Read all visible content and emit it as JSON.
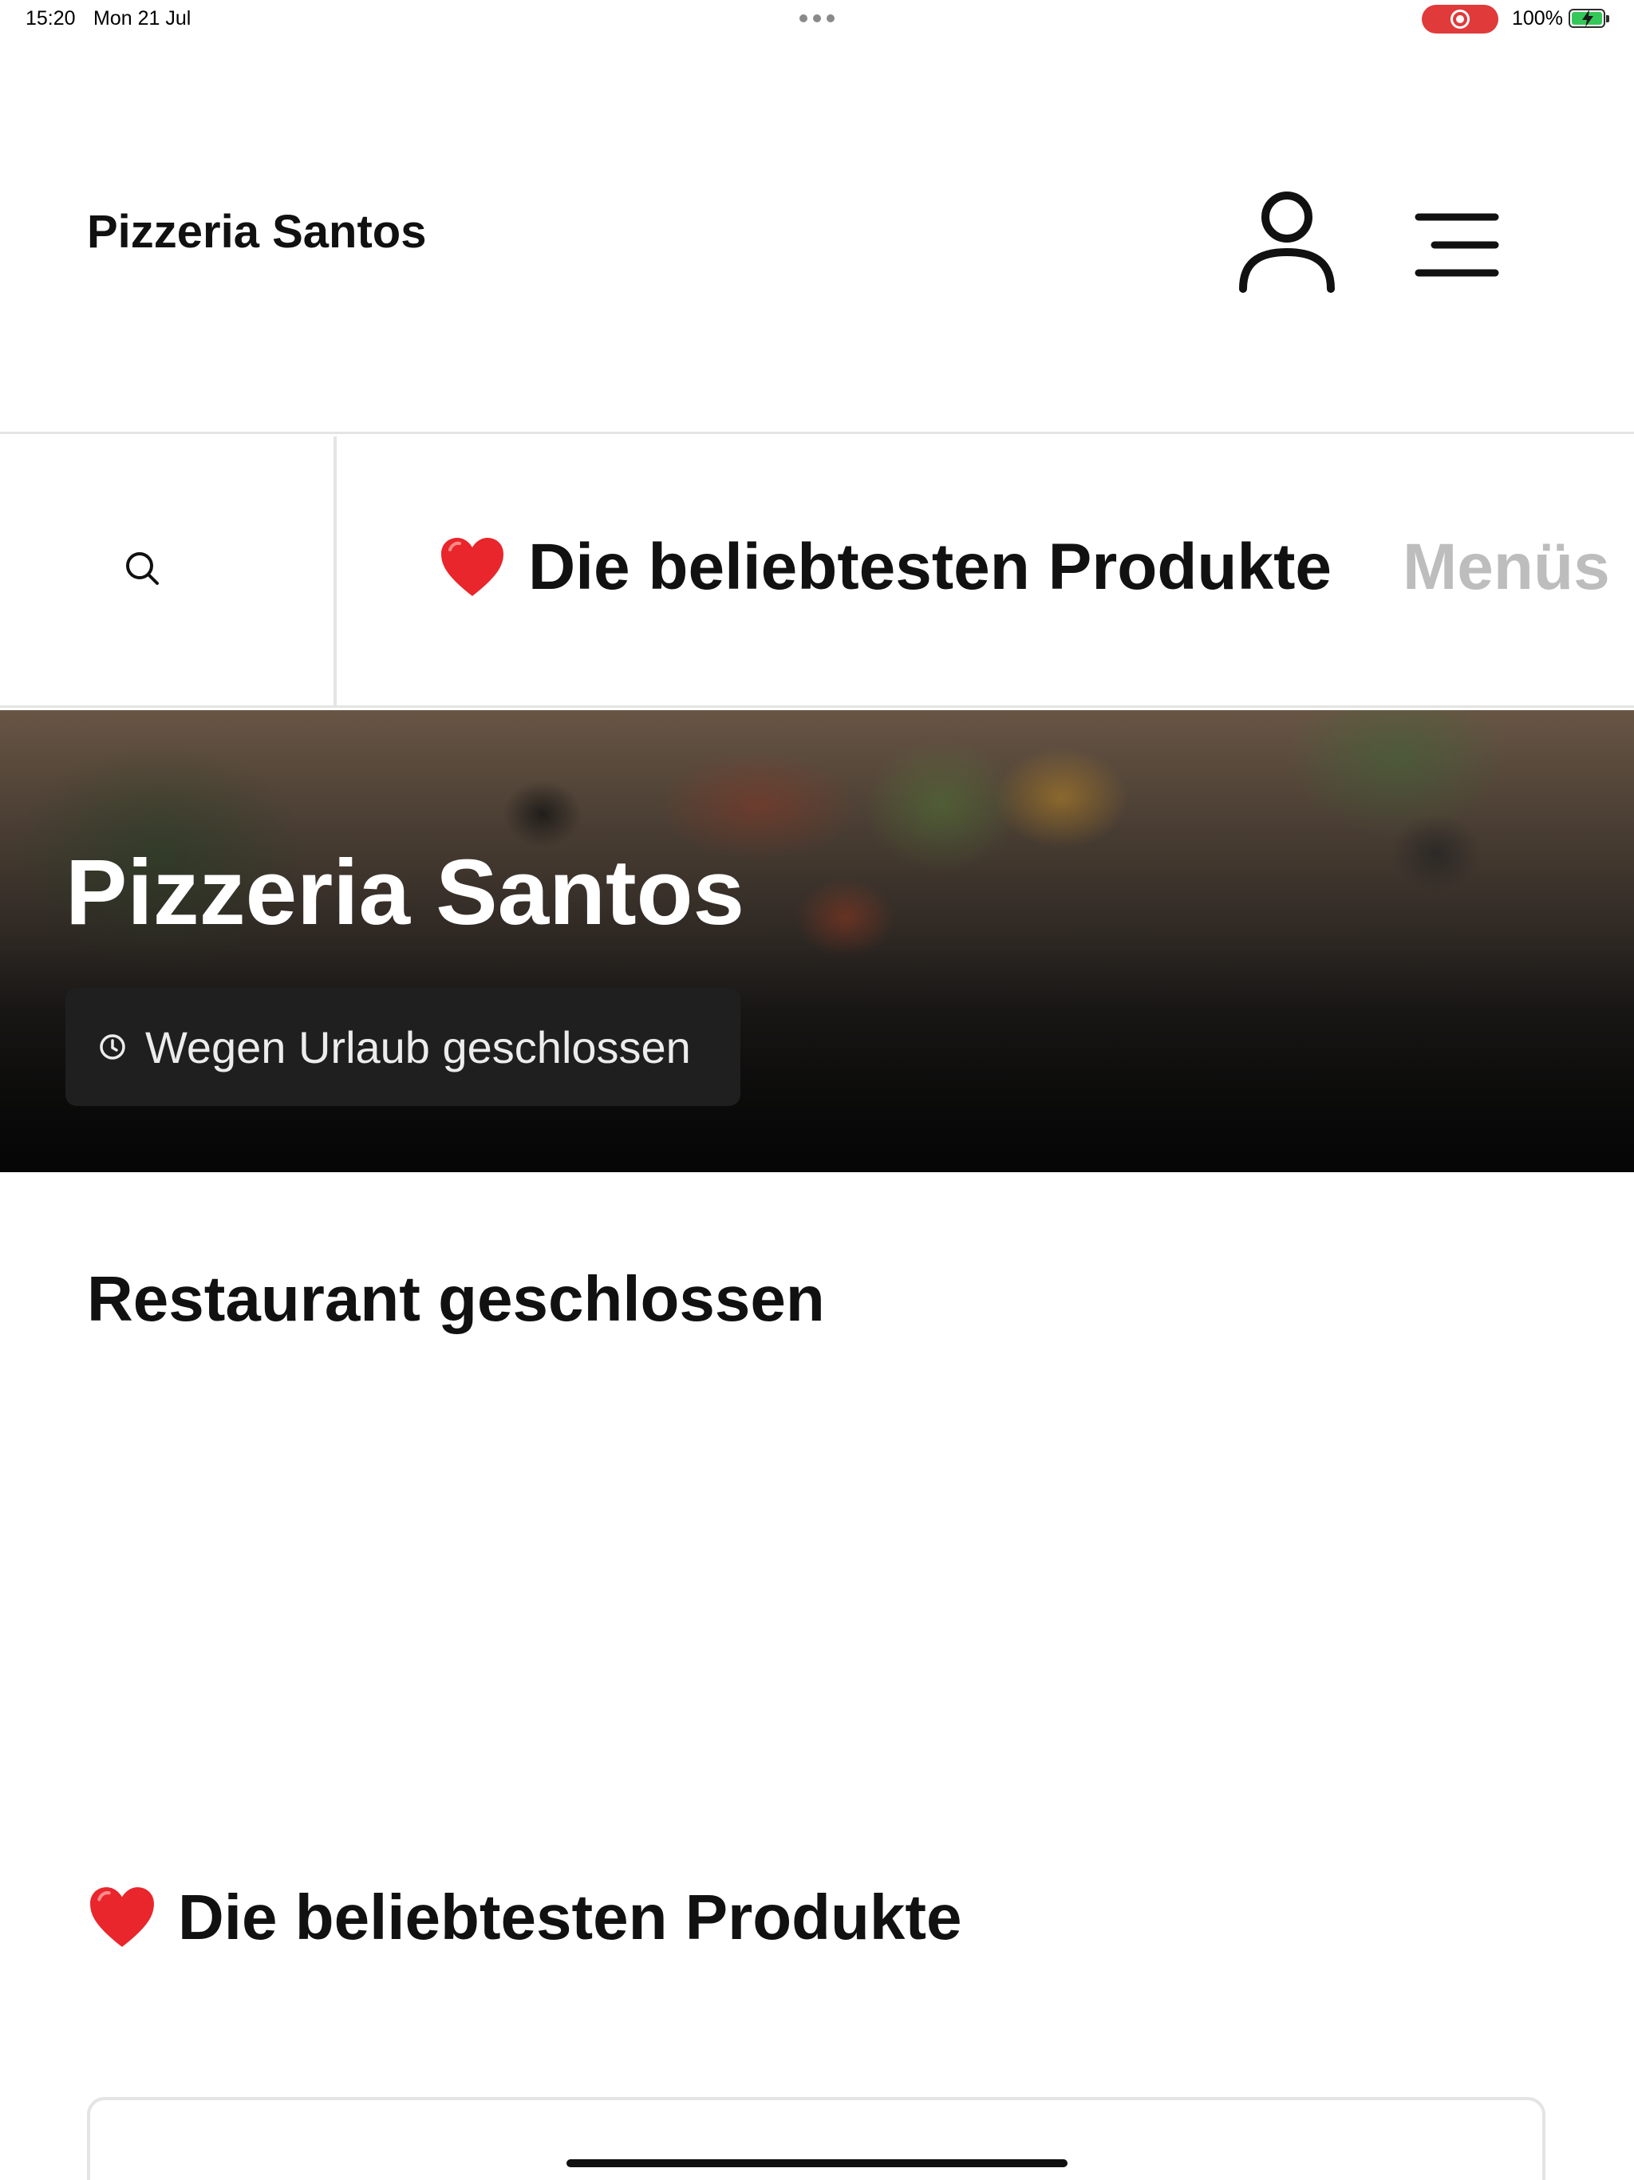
{
  "status_bar": {
    "time": "15:20",
    "date": "Mon 21 Jul",
    "battery_percent": "100%",
    "battery_level": 1.0,
    "screen_recording": true,
    "recording_color": "#e03a3a",
    "battery_color": "#35c759"
  },
  "header": {
    "brand": "Pizzeria Santos",
    "account_icon": "person-icon",
    "menu_icon": "hamburger-menu-icon"
  },
  "category_nav": {
    "search_icon": "search-icon",
    "tabs": [
      {
        "emoji": "❤️",
        "label": "Die beliebtesten Produkte",
        "active": true
      },
      {
        "label": "Menüs",
        "active": false
      }
    ]
  },
  "hero": {
    "title": "Pizzeria Santos",
    "status_icon": "clock-icon",
    "status_text": "Wegen Urlaub geschlossen"
  },
  "content": {
    "closed_heading": "Restaurant geschlossen",
    "section": {
      "emoji": "❤️",
      "title": "Die beliebtesten Produkte"
    }
  },
  "colors": {
    "text": "#111111",
    "inactive_tab": "#bdbdbd",
    "divider": "#e4e4e4",
    "chip_background": "#1f1f1f"
  }
}
